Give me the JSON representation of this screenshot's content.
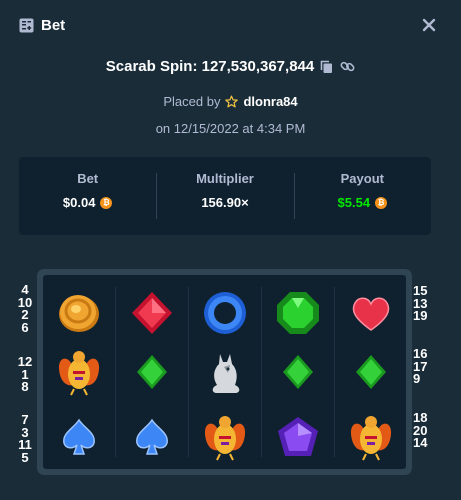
{
  "header": {
    "title": "Bet",
    "icon": "bet-slip-icon",
    "close_icon": "close-icon"
  },
  "spin": {
    "label": "Scarab Spin: 127,530,367,844",
    "icons": [
      "copy-icon",
      "link-icon"
    ]
  },
  "placed": {
    "prefix": "Placed by",
    "user": "dlonra84",
    "icon": "star-icon"
  },
  "date": "on 12/15/2022 at 4:34 PM",
  "stats": {
    "bet_label": "Bet",
    "bet_value": "$0.04",
    "multiplier_label": "Multiplier",
    "multiplier_value": "156.90×",
    "payout_label": "Payout",
    "payout_value": "$5.54",
    "payout_color": "#00e701",
    "coin_icon": "bitcoin-icon"
  },
  "paylines": {
    "left": [
      [
        "4",
        "10",
        "2",
        "6"
      ],
      [
        "12",
        "1",
        "8"
      ],
      [
        "7",
        "3",
        "11",
        "5"
      ]
    ],
    "right": [
      [
        "15",
        "13",
        "19"
      ],
      [
        "16",
        "17",
        "9"
      ],
      [
        "18",
        "20",
        "14"
      ]
    ]
  },
  "grid": [
    [
      "coin",
      "red-gem",
      "blue-ring",
      "green-gem",
      "heart"
    ],
    [
      "scarab",
      "green-diamond",
      "wolf",
      "green-diamond",
      "green-diamond"
    ],
    [
      "spade",
      "spade",
      "scarab",
      "purple-gem",
      "scarab"
    ]
  ],
  "colors": {
    "background": "#1a2c38",
    "panel": "#0f212e",
    "border": "#2f4553",
    "muted": "#b1bad3"
  }
}
